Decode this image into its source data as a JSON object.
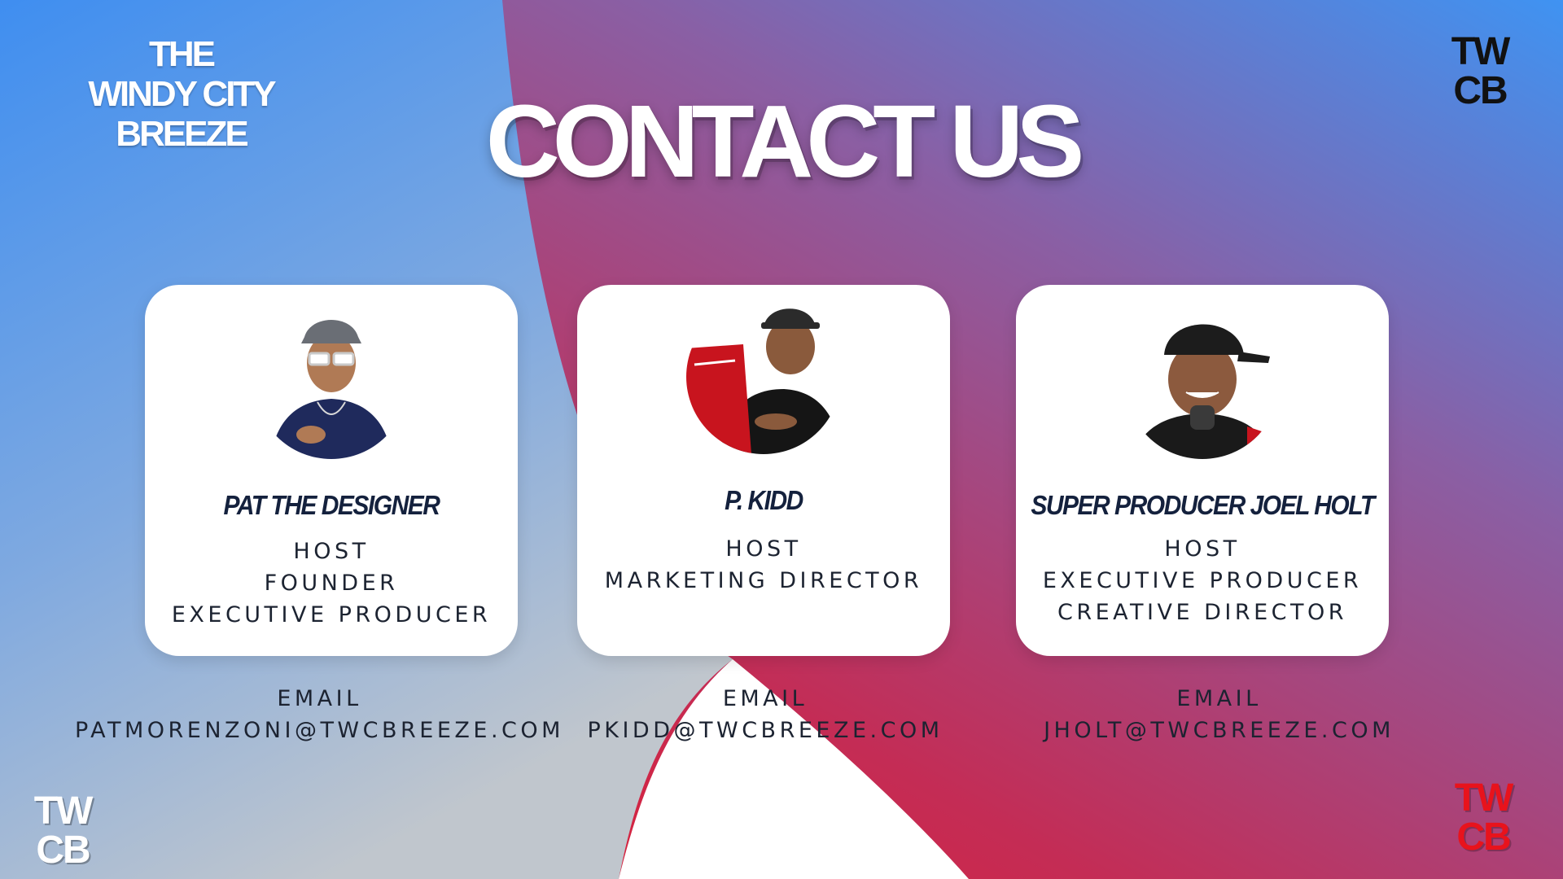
{
  "brand": {
    "logo_lines": [
      "THE",
      "WINDY CITY",
      "BREEZE"
    ],
    "badge_top_right": [
      "TW",
      "CB"
    ],
    "badge_bottom_left": [
      "TW",
      "CB"
    ],
    "badge_bottom_right": [
      "TW",
      "CB"
    ]
  },
  "page": {
    "title": "CONTACT US"
  },
  "colors": {
    "blue": "#4a93ee",
    "red": "#e8131c",
    "purple": "#8a5fa4",
    "card": "#ffffff",
    "name_text": "#14213d",
    "body_text": "#1c2331"
  },
  "team": [
    {
      "name": "PAT THE DESIGNER",
      "roles": [
        "HOST",
        "FOUNDER",
        "EXECUTIVE PRODUCER"
      ],
      "email_label": "EMAIL",
      "email": "PATMORENZONI@TWCBREEZE.COM"
    },
    {
      "name": "P. KIDD",
      "roles": [
        "HOST",
        "MARKETING DIRECTOR"
      ],
      "email_label": "EMAIL",
      "email": "PKIDD@TWCBREEZE.COM"
    },
    {
      "name": "SUPER PRODUCER JOEL HOLT",
      "roles": [
        "HOST",
        "EXECUTIVE PRODUCER",
        "CREATIVE DIRECTOR"
      ],
      "email_label": "EMAIL",
      "email": "JHOLT@TWCBREEZE.COM"
    }
  ]
}
